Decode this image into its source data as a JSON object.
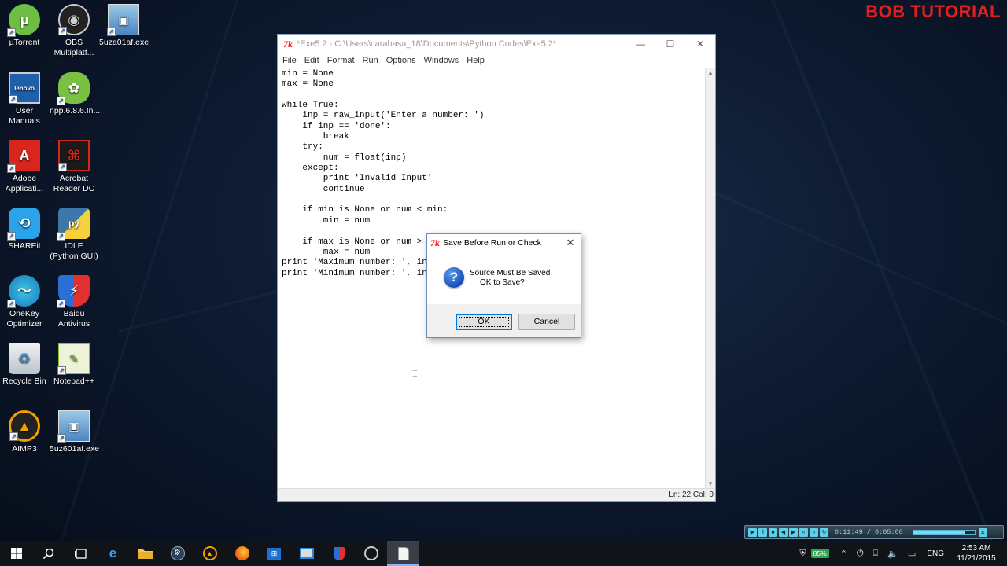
{
  "watermark": "BOB TUTORIAL",
  "desktop_icons": [
    {
      "label": "µTorrent"
    },
    {
      "label": "OBS Multiplatf..."
    },
    {
      "label": "5uza01af.exe"
    },
    {
      "label": "User Manuals"
    },
    {
      "label": "npp.6.8.6.In..."
    },
    {
      "label": "Adobe Applicati..."
    },
    {
      "label": "Acrobat Reader DC"
    },
    {
      "label": "SHAREit"
    },
    {
      "label": "IDLE (Python GUI)"
    },
    {
      "label": "OneKey Optimizer"
    },
    {
      "label": "Baidu Antivirus"
    },
    {
      "label": "Recycle Bin"
    },
    {
      "label": "Notepad++"
    },
    {
      "label": "AIMP3"
    },
    {
      "label": "5uz601af.exe"
    }
  ],
  "idle_window": {
    "logo": "7k",
    "title": "*Exe5.2 - C:\\Users\\carabasa_18\\Documents\\Python Codes\\Exe5.2*",
    "menu": [
      "File",
      "Edit",
      "Format",
      "Run",
      "Options",
      "Windows",
      "Help"
    ],
    "code_lines": [
      "min = None",
      "max = None",
      "",
      "while True:",
      "    inp = raw_input('Enter a number: ')",
      "    if inp == 'done':",
      "        break",
      "    try:",
      "        num = float(inp)",
      "    except:",
      "        print 'Invalid Input'",
      "        continue",
      "",
      "    if min is None or num < min:",
      "        min = num",
      "",
      "    if max is None or num > ",
      "        max = num",
      "print 'Maximum number: ', in",
      "print 'Minimum number: ', in"
    ],
    "status": "Ln: 22 Col: 0"
  },
  "dialog": {
    "logo": "7k",
    "title": "Save Before Run or Check",
    "message_line1": "Source Must Be Saved",
    "message_line2": "OK to Save?",
    "ok_label": "OK",
    "cancel_label": "Cancel"
  },
  "media_player": {
    "time": "0:11:49 / 0:05:00",
    "progress": 0.85
  },
  "taskbar": {
    "battery": "85%",
    "language": "ENG",
    "time": "2:53 AM",
    "date": "11/21/2015"
  }
}
